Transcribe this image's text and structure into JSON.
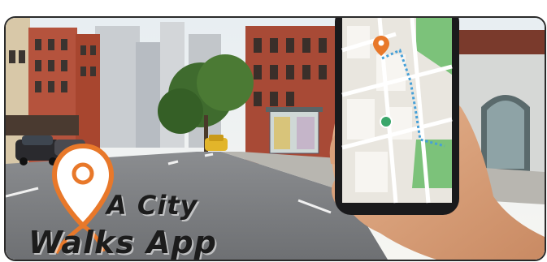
{
  "title": {
    "line1": "A City",
    "line2": "Walks App"
  },
  "colors": {
    "pin": "#e8782a",
    "map_park": "#7cc27a",
    "route": "#46a0d8",
    "location_dot": "#3aa66a"
  },
  "icons": [
    "location-pin-icon",
    "map-pin-icon",
    "current-location-icon"
  ]
}
